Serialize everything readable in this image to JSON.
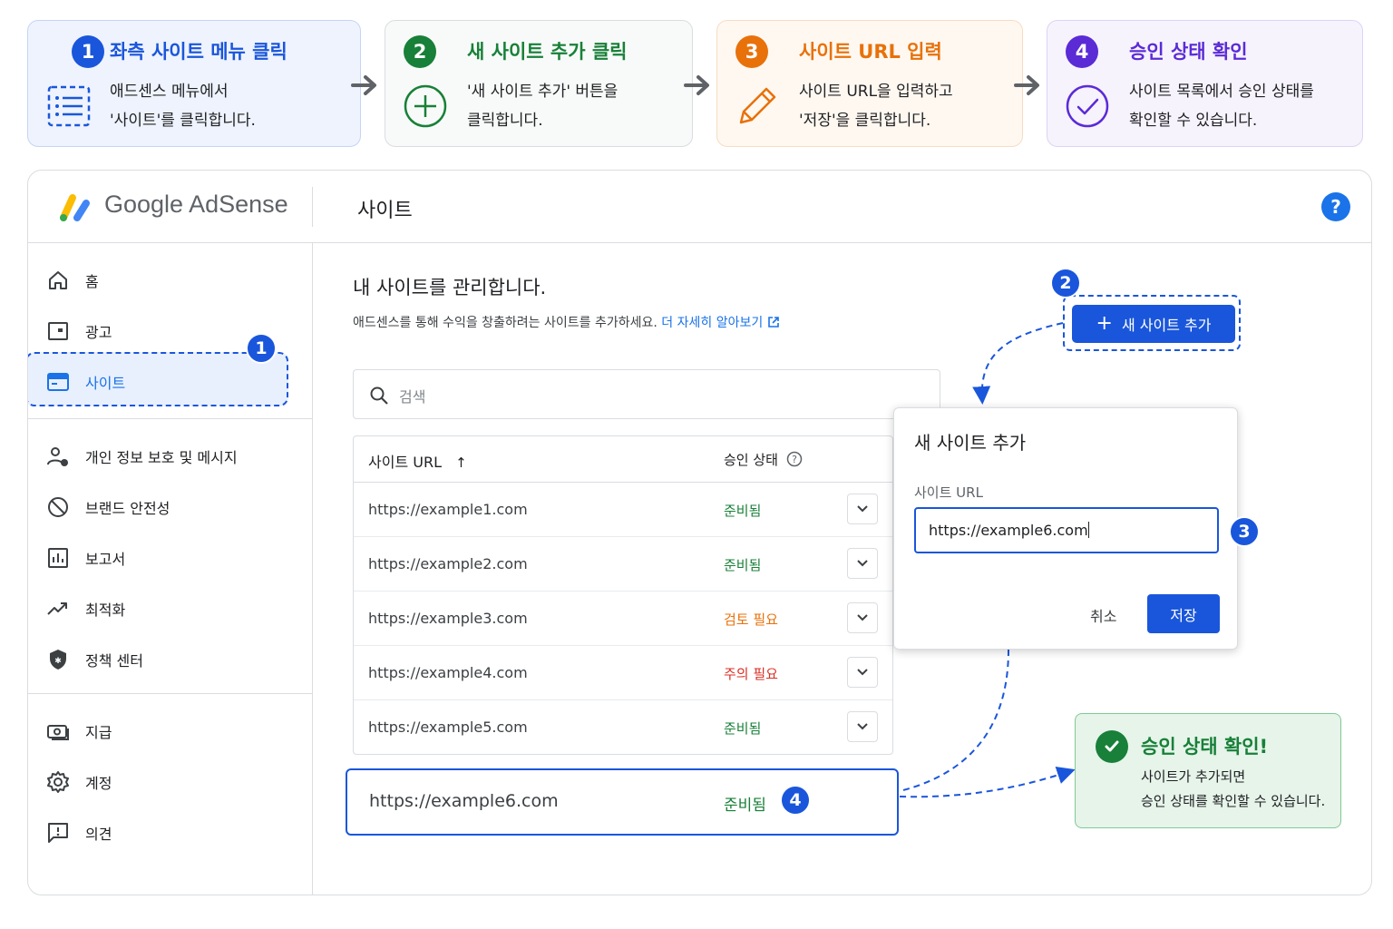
{
  "colors": {
    "step1": "#1a56db",
    "step2": "#188038",
    "step3": "#e8710a",
    "step4": "#5b2bd6",
    "primary": "#1a73e8",
    "ready": "#188038",
    "review": "#e8710a",
    "attention": "#d93025"
  },
  "steps": [
    {
      "num": "1",
      "title": "좌측 사이트 메뉴 클릭",
      "desc": "애드센스 메뉴에서\n'사이트'를 클릭합니다.",
      "icon": "list-icon"
    },
    {
      "num": "2",
      "title": "새 사이트 추가 클릭",
      "desc": "'새 사이트 추가' 버튼을\n클릭합니다.",
      "icon": "plus-circle-icon"
    },
    {
      "num": "3",
      "title": "사이트 URL 입력",
      "desc": "사이트 URL을 입력하고\n'저장'을 클릭합니다.",
      "icon": "pencil-icon"
    },
    {
      "num": "4",
      "title": "승인 상태 확인",
      "desc": "사이트 목록에서 승인 상태를\n확인할 수 있습니다.",
      "icon": "check-circle-icon"
    }
  ],
  "header": {
    "logo_text": "Google AdSense",
    "page_title": "사이트",
    "help": "?"
  },
  "sidebar": {
    "items": [
      {
        "label": "홈",
        "icon": "home-icon"
      },
      {
        "label": "광고",
        "icon": "ads-icon"
      },
      {
        "label": "사이트",
        "icon": "sites-icon"
      },
      {
        "label": "개인 정보 보호 및 메시지",
        "icon": "privacy-icon"
      },
      {
        "label": "브랜드 안전성",
        "icon": "block-icon"
      },
      {
        "label": "보고서",
        "icon": "reports-icon"
      },
      {
        "label": "최적화",
        "icon": "trending-icon"
      },
      {
        "label": "정책 센터",
        "icon": "shield-icon"
      },
      {
        "label": "지급",
        "icon": "payments-icon"
      },
      {
        "label": "계정",
        "icon": "gear-icon"
      },
      {
        "label": "의견",
        "icon": "feedback-icon"
      }
    ]
  },
  "main": {
    "heading": "내 사이트를 관리합니다.",
    "subtitle": "애드센스를 통해 수익을 창출하려는 사이트를 추가하세요.",
    "learn_more": "더 자세히 알아보기",
    "add_site_button": "새 사이트 추가",
    "search_placeholder": "검색",
    "table": {
      "col_url": "사이트 URL",
      "col_status": "승인 상태",
      "rows": [
        {
          "url": "https://example1.com",
          "status": "준비됨",
          "status_type": "ready"
        },
        {
          "url": "https://example2.com",
          "status": "준비됨",
          "status_type": "ready"
        },
        {
          "url": "https://example3.com",
          "status": "검토 필요",
          "status_type": "review"
        },
        {
          "url": "https://example4.com",
          "status": "주의 필요",
          "status_type": "attention"
        },
        {
          "url": "https://example5.com",
          "status": "준비됨",
          "status_type": "ready"
        }
      ]
    },
    "new_row": {
      "url": "https://example6.com",
      "status": "준비됨"
    }
  },
  "dialog": {
    "title": "새 사이트 추가",
    "field_label": "사이트 URL",
    "field_value": "https://example6.com",
    "cancel": "취소",
    "save": "저장"
  },
  "callout": {
    "title": "승인 상태 확인!",
    "body": "사이트가 추가되면\n승인 상태를 확인할 수 있습니다."
  },
  "badges": {
    "b1": "1",
    "b2": "2",
    "b3": "3",
    "b4": "4"
  }
}
